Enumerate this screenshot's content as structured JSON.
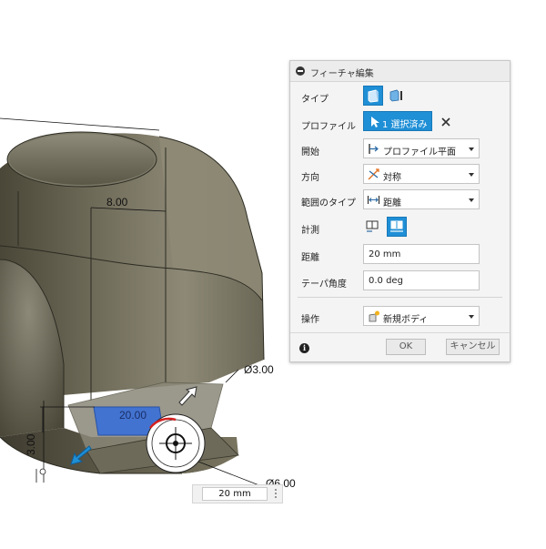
{
  "viewport": {
    "dims": {
      "top_width": "8.00",
      "hole_small": "Ø3.00",
      "hole_large": "Ø6.00",
      "height": "3.00",
      "on_shape": "20.00"
    },
    "distance_input": {
      "value": "20 mm"
    }
  },
  "dialog": {
    "title": "フィーチャ編集",
    "rows": {
      "type": {
        "label": "タイプ"
      },
      "profile": {
        "label": "プロファイル",
        "value": "1 選択済み"
      },
      "start": {
        "label": "開始",
        "value": "プロファイル平面"
      },
      "direction": {
        "label": "方向",
        "value": "対称"
      },
      "extent": {
        "label": "範囲のタイプ",
        "value": "距離"
      },
      "measure": {
        "label": "計測"
      },
      "distance": {
        "label": "距離",
        "value": "20 mm"
      },
      "taper": {
        "label": "テーパ角度",
        "value": "0.0 deg"
      },
      "operation": {
        "label": "操作",
        "value": "新規ボディ"
      }
    },
    "buttons": {
      "ok": "OK",
      "cancel": "キャンセル"
    }
  },
  "colors": {
    "accent": "#1f8fd6",
    "profile_blue": "#3a6fd8",
    "arrow_red": "#d42020"
  }
}
